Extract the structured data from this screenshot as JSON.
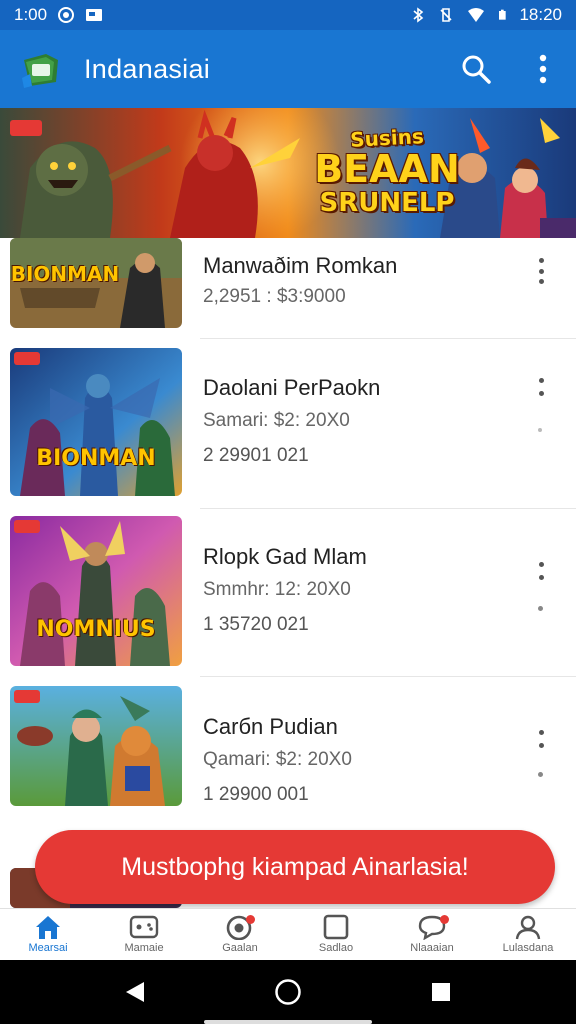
{
  "status_bar": {
    "time": "1:00",
    "clock_right": "18:20",
    "icons": [
      "circle-badge-icon",
      "image-notification-icon",
      "bluetooth-icon",
      "vibrate-icon",
      "wifi-icon",
      "battery-icon"
    ]
  },
  "app_bar": {
    "title": "Indanasiai",
    "icons": [
      "app-logo-icon",
      "search-icon",
      "more-vert-icon"
    ]
  },
  "banner": {
    "line1": "Susins",
    "line2": "BEAAN",
    "line3": "SRUNELP"
  },
  "items": [
    {
      "title": "Manwaðim Romkan",
      "subtitle": "2,2951 : $3:9000",
      "code": "",
      "thumb_text": "BIONMAN"
    },
    {
      "title": "Daolani PerPaokn",
      "subtitle": "Samari: $2: 20X0",
      "code": "2 29901 021",
      "thumb_text": "BIONMAN"
    },
    {
      "title": "Rlopk Gad Mlam",
      "subtitle": "Smmhr: 12: 20X0",
      "code": "1 35720 021",
      "thumb_text": "NOMNIUS"
    },
    {
      "title": "Carбn Pudian",
      "subtitle": "Qamari: $2: 20X0",
      "code": "1 29900 001",
      "thumb_text": ""
    }
  ],
  "cta": {
    "label": "Mustbophg kiampad Ainarlasia!"
  },
  "bottom_nav": [
    {
      "label": "Mearsai",
      "icon": "home-icon",
      "active": true
    },
    {
      "label": "Mamaie",
      "icon": "gamepad-icon",
      "active": false
    },
    {
      "label": "Gaalan",
      "icon": "target-icon",
      "active": false
    },
    {
      "label": "Sadlao",
      "icon": "square-icon",
      "active": false
    },
    {
      "label": "Nlaaaian",
      "icon": "chat-bubble-icon",
      "active": false
    },
    {
      "label": "Lulasdana",
      "icon": "profile-icon",
      "active": false
    }
  ],
  "colors": {
    "primary": "#1976d2",
    "status_bar": "#1565c0",
    "cta": "#e53935",
    "active_nav": "#1976d2"
  }
}
